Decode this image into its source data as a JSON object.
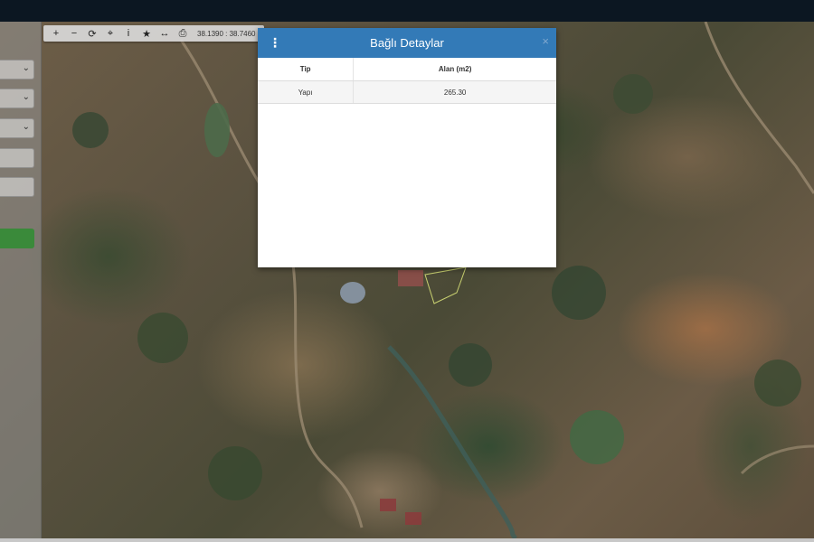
{
  "map": {
    "toolbar": {
      "tools": [
        {
          "name": "zoom-in-button",
          "glyph": "+"
        },
        {
          "name": "zoom-out-button",
          "glyph": "−"
        },
        {
          "name": "refresh-button",
          "glyph": "⟳"
        },
        {
          "name": "locate-button",
          "glyph": "⌖"
        },
        {
          "name": "info-button",
          "glyph": "i"
        },
        {
          "name": "favorite-button",
          "glyph": "★"
        },
        {
          "name": "measure-button",
          "glyph": "↔"
        },
        {
          "name": "print-button",
          "glyph": "⎙"
        }
      ],
      "coordinates": "38.1390 : 38.7460"
    }
  },
  "dialog": {
    "title": "Bağlı Detaylar",
    "menu_icon": "vertical-dots-icon",
    "close_icon": "close-icon",
    "close_glyph": "×",
    "columns": [
      "Tip",
      "Alan (m2)"
    ],
    "rows": [
      [
        "Yapı",
        "265.30"
      ]
    ]
  },
  "colors": {
    "header": "#337ab7",
    "accent_button": "#3a8a3a"
  }
}
